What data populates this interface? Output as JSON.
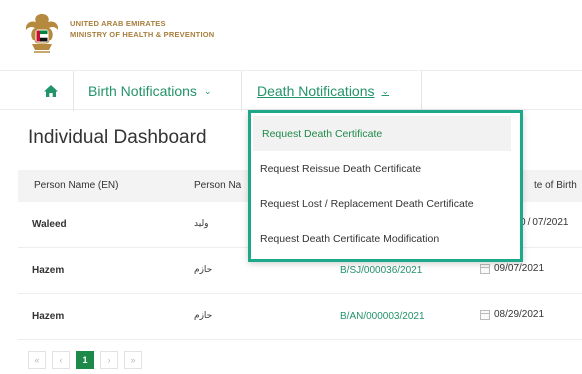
{
  "header": {
    "org_line1": "UNITED ARAB EMIRATES",
    "org_line2": "MINISTRY OF HEALTH & PREVENTION"
  },
  "nav": {
    "home_icon": "home-icon",
    "birth_label": "Birth Notifications",
    "death_label": "Death Notifications"
  },
  "page": {
    "title": "Individual Dashboard"
  },
  "table": {
    "columns": [
      "Person Name (EN)",
      "Person Na",
      "te of Birth"
    ],
    "rows": [
      {
        "name_en": "Waleed",
        "name_ar": "وليد",
        "ref": "",
        "dob": "0 / 07/2021"
      },
      {
        "name_en": "Hazem",
        "name_ar": "حازم",
        "ref": "B/SJ/000036/2021",
        "dob": "09/07/2021"
      },
      {
        "name_en": "Hazem",
        "name_ar": "حازم",
        "ref": "B/AN/000003/2021",
        "dob": "08/29/2021"
      }
    ]
  },
  "pagination": {
    "first": "«",
    "prev": "‹",
    "current": "1",
    "next": "›",
    "last": "»"
  },
  "dropdown": {
    "items": [
      "Request Death Certificate",
      "Request Reissue Death Certificate",
      "Request Lost / Replacement Death Certificate",
      "Request Death Certificate Modification"
    ]
  },
  "colors": {
    "accent": "#23936a",
    "org_gold": "#a87e3c",
    "dropdown_border": "#1ea88a",
    "page_active": "#1e8a4a"
  }
}
